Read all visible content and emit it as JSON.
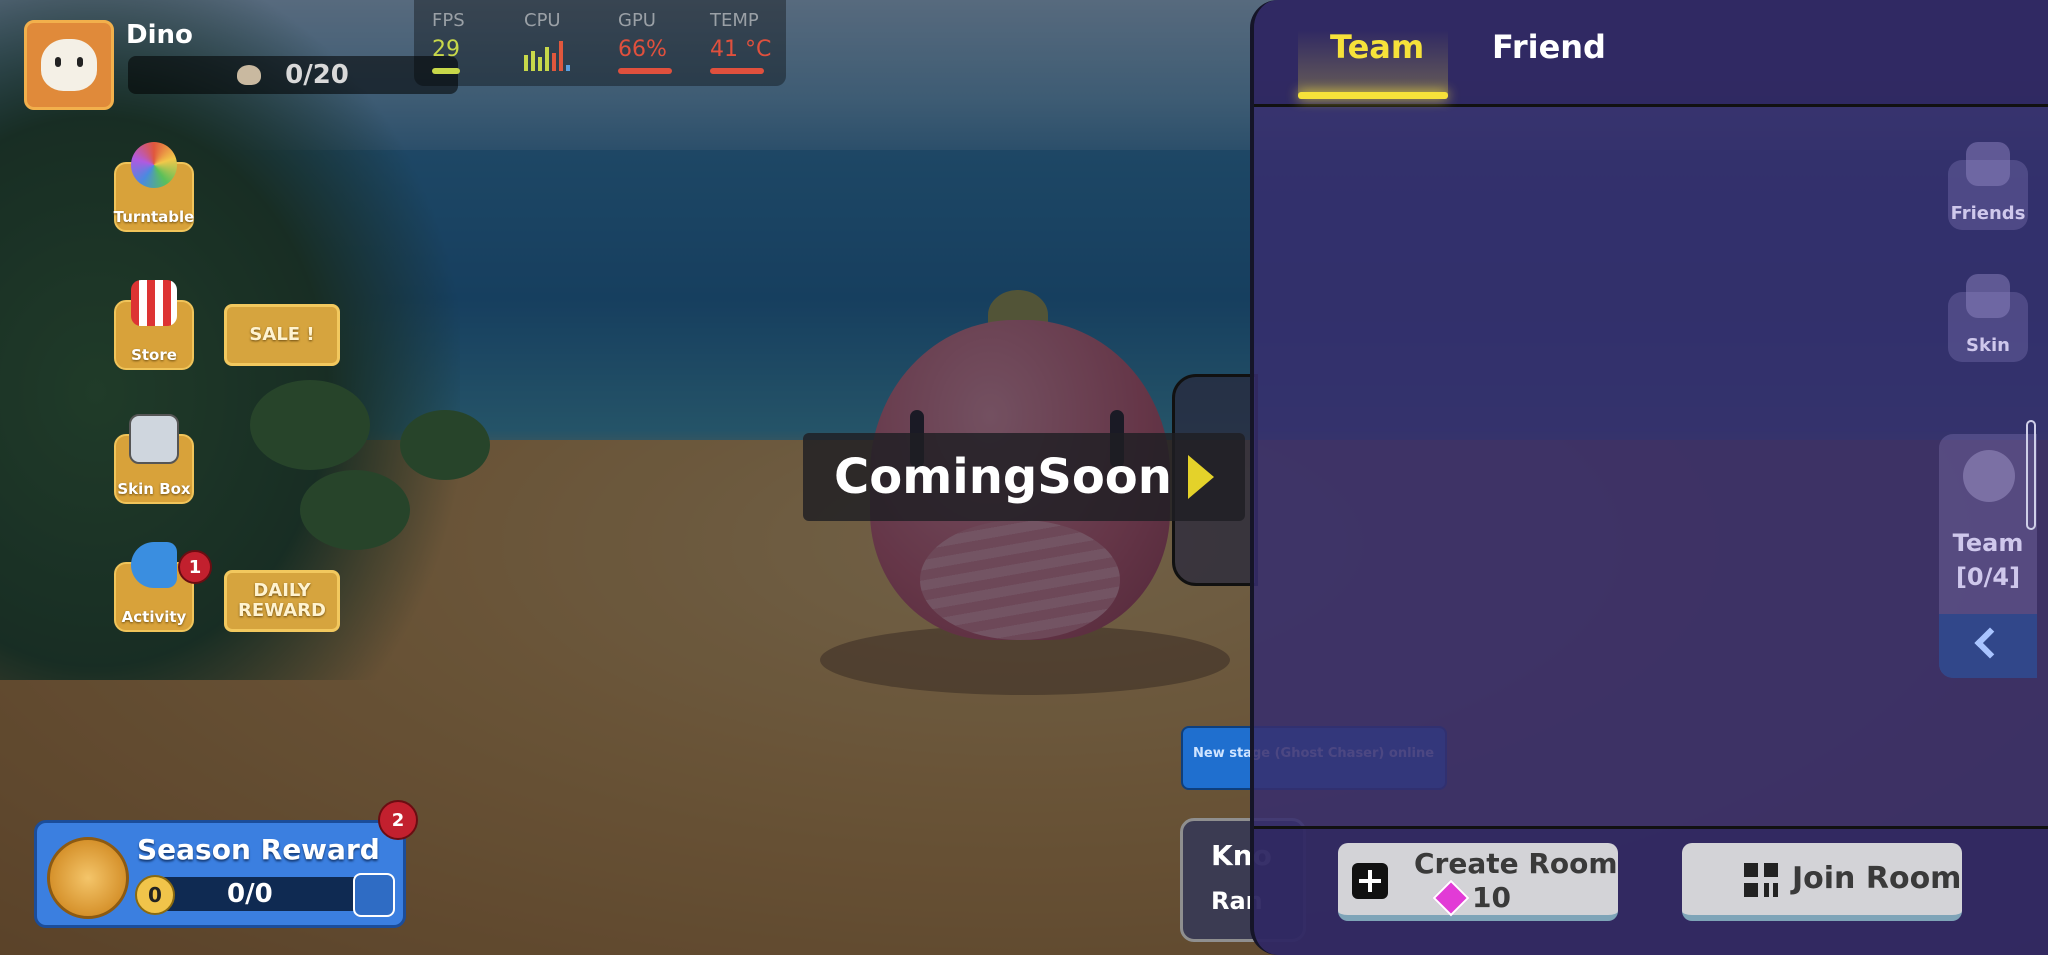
{
  "player": {
    "name": "Dino",
    "progress": "0/20"
  },
  "perf": {
    "fps": {
      "label": "FPS",
      "value": "29"
    },
    "cpu": {
      "label": "CPU"
    },
    "gpu": {
      "label": "GPU",
      "value": "66%"
    },
    "temp": {
      "label": "TEMP",
      "value": "41 °C"
    }
  },
  "side_menu": {
    "turntable": "Turntable",
    "store": "Store",
    "sale": "SALE !",
    "skin_box": "Skin Box",
    "activity": "Activity",
    "activity_badge": "1",
    "daily_reward": "DAILY REWARD"
  },
  "season": {
    "title": "Season Reward",
    "level": "0",
    "score": "0/0",
    "badge": "2"
  },
  "overlay": {
    "coming_soon": "ComingSoon"
  },
  "stage_tip": "New stage (Ghost Chaser) online",
  "mode_card": {
    "title": "Kno",
    "subtitle": "Ran"
  },
  "panel": {
    "tabs": {
      "team": "Team",
      "friend": "Friend"
    },
    "right_buttons": {
      "friends": "Friends",
      "skin": "Skin"
    },
    "team_side": {
      "label": "Team",
      "count": "[0/4]"
    },
    "create_room": {
      "label": "Create Room",
      "cost": "10"
    },
    "join_room": {
      "label": "Join Room"
    }
  },
  "colors": {
    "active_tab": "#f6e23a",
    "panel_bg": "#372d6e",
    "button_bg": "#d3d3d7",
    "gem": "#e23bd6"
  }
}
